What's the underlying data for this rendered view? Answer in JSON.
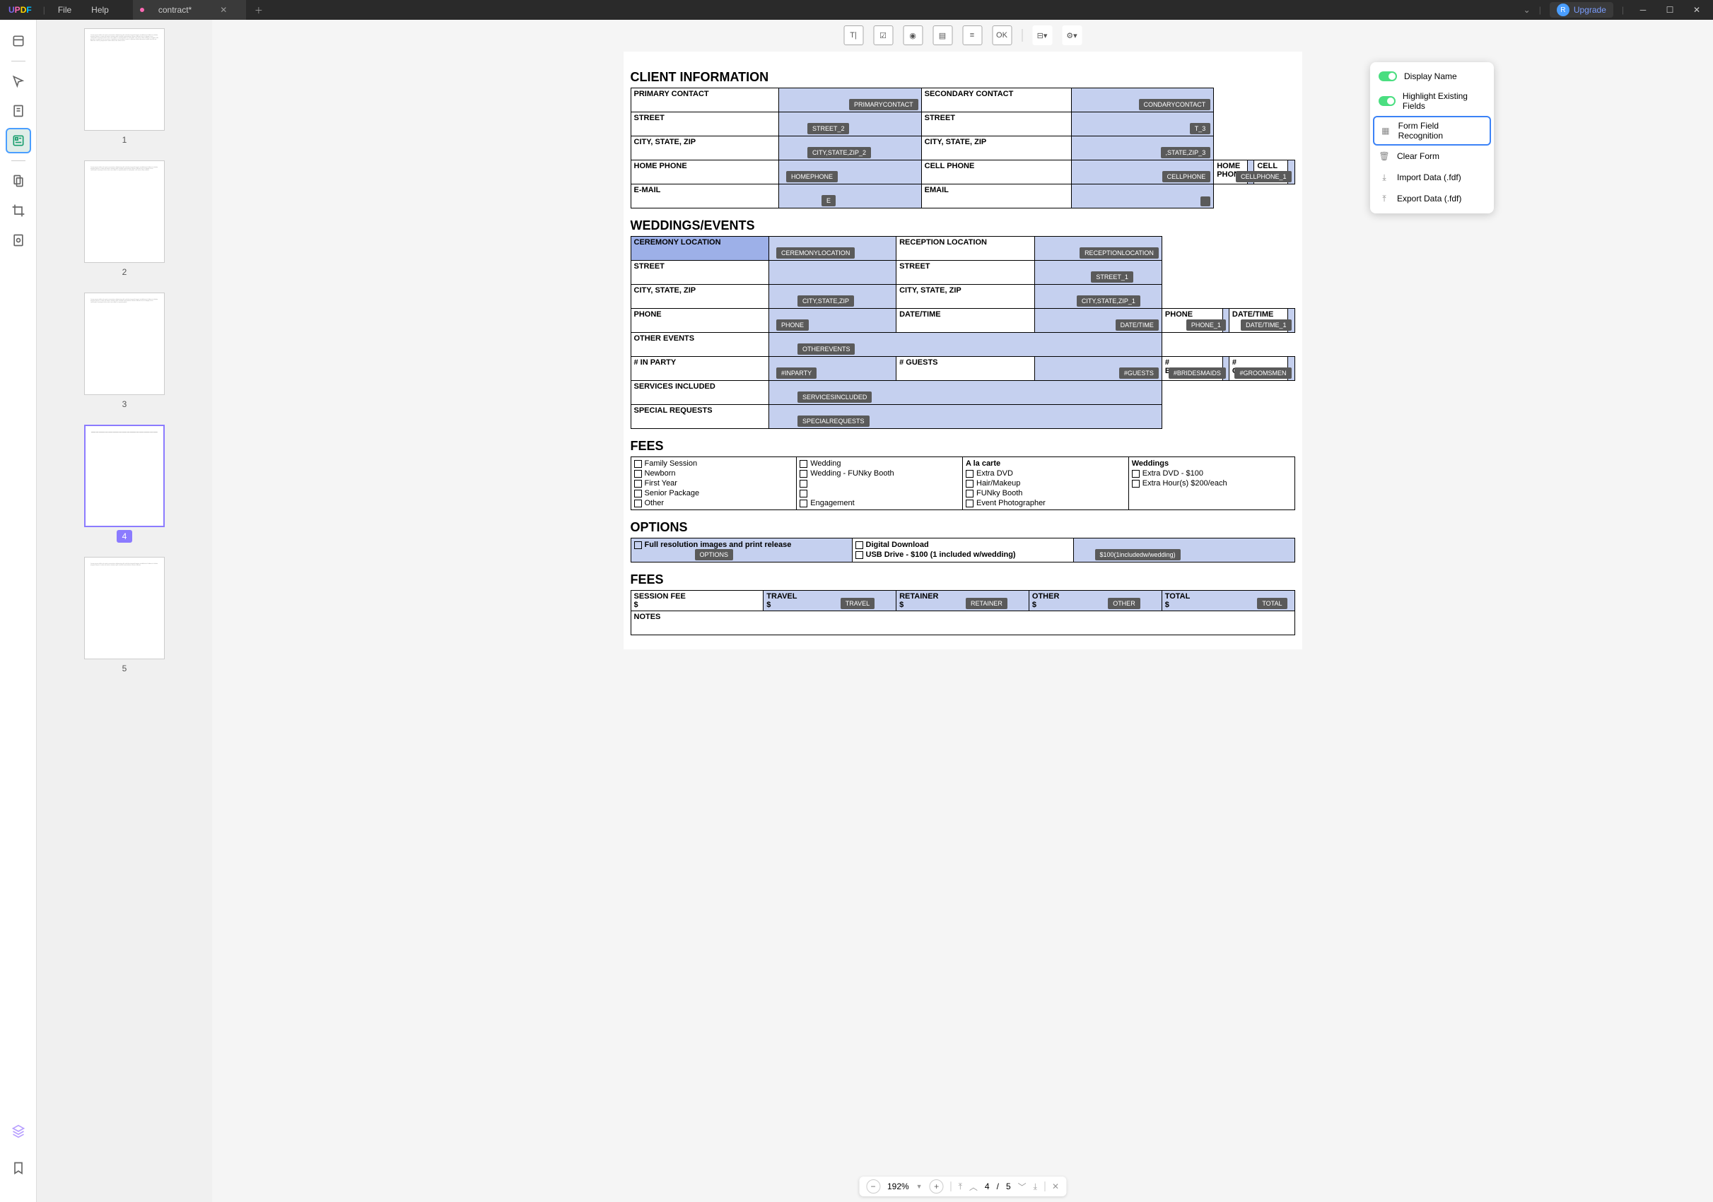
{
  "titlebar": {
    "menu_file": "File",
    "menu_help": "Help",
    "tab_title": "contract*",
    "upgrade": "Upgrade",
    "upgrade_letter": "R"
  },
  "thumbs": {
    "labels": [
      "1",
      "2",
      "3",
      "4",
      "5"
    ],
    "selected": 4
  },
  "dropdown": {
    "display_name": "Display Name",
    "highlight": "Highlight Existing Fields",
    "recognition": "Form Field Recognition",
    "clear": "Clear Form",
    "import": "Import Data (.fdf)",
    "export": "Export Data (.fdf)"
  },
  "doc": {
    "s1": {
      "title": "CLIENT INFORMATION",
      "rows": [
        [
          "PRIMARY CONTACT",
          "PRIMARYCONTACT",
          "SECONDARY CONTACT",
          "CONDARYCONTACT"
        ],
        [
          "STREET",
          "STREET_2",
          "STREET",
          "T_3"
        ],
        [
          "CITY, STATE, ZIP",
          "CITY,STATE,ZIP_2",
          "CITY, STATE, ZIP",
          ",STATE,ZIP_3"
        ],
        [
          "HOME PHONE",
          "HOMEPHONE",
          "CELL PHONE",
          "CELLPHONE",
          "HOME PHONE",
          "",
          "CELL PHONE",
          "CELLPHONE_1"
        ],
        [
          "E-MAIL",
          "E",
          "EMAIL",
          ""
        ]
      ]
    },
    "s2": {
      "title": "WEDDINGS/EVENTS",
      "rows": [
        [
          "CEREMONY LOCATION",
          "CEREMONYLOCATION",
          "RECEPTION LOCATION",
          "RECEPTIONLOCATION"
        ],
        [
          "STREET",
          "",
          "STREET",
          "STREET_1"
        ],
        [
          "CITY, STATE, ZIP",
          "CITY,STATE,ZIP",
          "CITY, STATE, ZIP",
          "CITY,STATE,ZIP_1"
        ],
        [
          "PHONE",
          "PHONE",
          "DATE/TIME",
          "DATE/TIME",
          "PHONE",
          "PHONE_1",
          "DATE/TIME",
          "DATE/TIME_1"
        ],
        [
          "OTHER EVENTS",
          "OTHEREVENTS"
        ],
        [
          "# IN PARTY",
          "#INPARTY",
          "# GUESTS",
          "#GUESTS",
          "# BRIDESMAIDS",
          "#BRIDESMAIDS",
          "# GROOMSMEN",
          "#GROOMSMEN"
        ],
        [
          "SERVICES INCLUDED",
          "SERVICESINCLUDED"
        ],
        [
          "SPECIAL REQUESTS",
          "SPECIALREQUESTS"
        ]
      ]
    },
    "s3": {
      "title": "FEES",
      "col1": [
        "Family Session",
        "Newborn",
        "First Year",
        "Senior Package",
        "Other"
      ],
      "col2": [
        "Wedding",
        "Wedding - FUNky Booth",
        "",
        "",
        "Engagement"
      ],
      "col3h": "A la carte",
      "col3": [
        "Extra DVD",
        "Hair/Makeup",
        "FUNky Booth",
        "Event Photographer"
      ],
      "col4h": "Weddings",
      "col4": [
        "Extra DVD - $100",
        "Extra Hour(s) $200/each"
      ]
    },
    "s4": {
      "title": "OPTIONS",
      "c1": "Full resolution images and print release",
      "c1tag": "OPTIONS",
      "c2a": "Digital Download",
      "c2b": "USB Drive - $100 (1 included w/wedding)",
      "c3tag": "$100(1includedw/wedding)"
    },
    "s5": {
      "title": "FEES",
      "cols": [
        "SESSION FEE",
        "TRAVEL",
        "RETAINER",
        "OTHER",
        "TOTAL"
      ],
      "tags": [
        "",
        "TRAVEL",
        "RETAINER",
        "OTHER",
        "TOTAL"
      ],
      "dollar": "$",
      "notes": "NOTES"
    }
  },
  "bottombar": {
    "zoom": "192%",
    "page": "4",
    "sep": "/",
    "total": "5"
  }
}
